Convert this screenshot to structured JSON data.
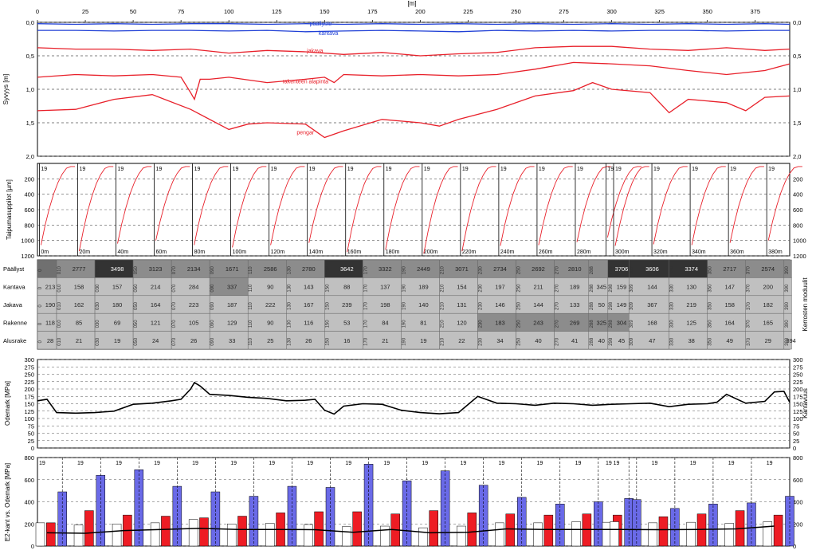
{
  "colors": {
    "blue_line": "#1f3fd6",
    "red_line": "#e8202a",
    "grid": "#555555",
    "table_cell": "#c0c0c0",
    "table_mid": "#8c8c8c",
    "table_dark": "#333333",
    "table_header": "#707070",
    "bar_red": "#ee1c24",
    "bar_blue": "#6a6ae8",
    "bar_white": "#ffffff"
  },
  "chart_data": [
    {
      "type": "line",
      "panel": "layers",
      "xlabel": "[m]",
      "ylabel": "Syvyys [m]",
      "xlim": [
        0,
        393
      ],
      "ylim": [
        2.0,
        0.0
      ],
      "xticks": [
        "0",
        "25",
        "50",
        "75",
        "100",
        "125",
        "150",
        "175",
        "200",
        "225",
        "250",
        "275",
        "300",
        "325",
        "350",
        "375"
      ],
      "xtick_values": [
        0,
        25,
        50,
        75,
        100,
        125,
        150,
        175,
        200,
        225,
        250,
        275,
        300,
        325,
        350,
        375
      ],
      "yticks": [
        "0,0",
        "0,5",
        "1,0",
        "1,5",
        "2,0"
      ],
      "ytick_values": [
        0,
        0.5,
        1.0,
        1.5,
        2.0
      ],
      "grid": true,
      "series": [
        {
          "name": "päällyste",
          "color": "blue",
          "x": [
            0,
            20,
            40,
            60,
            80,
            100,
            120,
            140,
            160,
            180,
            200,
            220,
            240,
            260,
            280,
            300,
            320,
            340,
            360,
            380,
            393
          ],
          "values": [
            0.02,
            0.03,
            0.02,
            0.03,
            0.02,
            0.02,
            0.03,
            0.02,
            0.03,
            0.02,
            0.03,
            0.02,
            0.03,
            0.02,
            0.03,
            0.02,
            0.03,
            0.02,
            0.03,
            0.02,
            0.03
          ]
        },
        {
          "name": "kantava",
          "color": "blue",
          "x": [
            0,
            20,
            40,
            60,
            80,
            100,
            120,
            140,
            160,
            180,
            200,
            220,
            240,
            260,
            280,
            300,
            320,
            340,
            360,
            380,
            393
          ],
          "values": [
            0.12,
            0.12,
            0.13,
            0.12,
            0.12,
            0.13,
            0.12,
            0.14,
            0.13,
            0.12,
            0.13,
            0.14,
            0.12,
            0.13,
            0.12,
            0.13,
            0.12,
            0.12,
            0.13,
            0.12,
            0.12
          ]
        },
        {
          "name": "jakava",
          "color": "red",
          "x": [
            0,
            20,
            40,
            60,
            80,
            100,
            120,
            140,
            160,
            180,
            200,
            220,
            240,
            260,
            280,
            300,
            320,
            340,
            360,
            380,
            393
          ],
          "values": [
            0.38,
            0.4,
            0.4,
            0.42,
            0.4,
            0.46,
            0.42,
            0.44,
            0.48,
            0.45,
            0.5,
            0.47,
            0.45,
            0.38,
            0.36,
            0.36,
            0.4,
            0.42,
            0.38,
            0.42,
            0.4
          ]
        },
        {
          "name": "rakenteen alapinta",
          "color": "red",
          "x": [
            0,
            20,
            40,
            60,
            75,
            80,
            82,
            85,
            90,
            100,
            120,
            140,
            150,
            155,
            160,
            180,
            200,
            220,
            240,
            260,
            280,
            300,
            320,
            340,
            360,
            380,
            393
          ],
          "values": [
            0.82,
            0.78,
            0.8,
            0.78,
            0.82,
            1.05,
            1.15,
            0.85,
            0.85,
            0.82,
            0.9,
            0.85,
            0.82,
            0.9,
            0.78,
            0.8,
            0.78,
            0.8,
            0.78,
            0.7,
            0.6,
            0.62,
            0.65,
            0.72,
            0.78,
            0.72,
            0.62
          ]
        },
        {
          "name": "pengar",
          "color": "red",
          "x": [
            0,
            20,
            40,
            60,
            80,
            100,
            110,
            120,
            140,
            150,
            160,
            180,
            200,
            210,
            220,
            240,
            260,
            280,
            290,
            300,
            320,
            330,
            340,
            360,
            370,
            380,
            393
          ],
          "values": [
            1.32,
            1.3,
            1.15,
            1.08,
            1.3,
            1.6,
            1.52,
            1.5,
            1.52,
            1.72,
            1.62,
            1.45,
            1.5,
            1.55,
            1.45,
            1.3,
            1.1,
            1.02,
            0.9,
            1.0,
            1.05,
            1.35,
            1.15,
            1.2,
            1.32,
            1.12,
            1.1
          ]
        }
      ]
    },
    {
      "type": "line",
      "panel": "deflection",
      "ylabel": "Taipumasuppilot [µm]",
      "ylim": [
        1200,
        0
      ],
      "yticks": [
        "200",
        "400",
        "600",
        "800",
        "1000",
        "1200"
      ],
      "ytick_values": [
        200,
        400,
        600,
        800,
        1000,
        1200
      ],
      "cell_tag": "19",
      "stations": [
        0,
        20,
        40,
        60,
        80,
        100,
        120,
        140,
        160,
        180,
        200,
        220,
        240,
        260,
        280,
        296,
        300,
        320,
        340,
        360,
        380
      ],
      "station_labels": [
        "0m",
        "20m",
        "40m",
        "60m",
        "80m",
        "100m",
        "120m",
        "140m",
        "160m",
        "180m",
        "200m",
        "220m",
        "240m",
        "260m",
        "280m",
        "",
        "300m",
        "320m",
        "340m",
        "360m",
        "380m"
      ],
      "d0_values": [
        1000,
        1080,
        980,
        940,
        1000,
        1030,
        1000,
        970,
        1090,
        1060,
        1110,
        1080,
        1010,
        1000,
        960,
        900,
        1010,
        990,
        1000,
        970,
        940
      ]
    },
    {
      "type": "table",
      "panel": "moduli",
      "ylabel": "Kerrosten moduulit",
      "rows": [
        "Päällyst",
        "Kantava",
        "Jakava",
        "Rakenne",
        "Alusrake"
      ],
      "columns": [
        {
          "start": "0",
          "end": "010",
          "values": [
            "",
            "213",
            "190",
            "118",
            "28"
          ],
          "shade": [
            "header",
            "cell",
            "cell",
            "cell",
            "cell"
          ]
        },
        {
          "start": "010",
          "end": "030",
          "values": [
            "2777",
            "158",
            "162",
            "85",
            "21"
          ],
          "shade": [
            "mid",
            "cell",
            "cell",
            "cell",
            "cell"
          ]
        },
        {
          "start": "030",
          "end": "050",
          "values": [
            "3498",
            "157",
            "180",
            "69",
            "19"
          ],
          "shade": [
            "dark",
            "cell",
            "cell",
            "cell",
            "cell"
          ]
        },
        {
          "start": "050",
          "end": "070",
          "values": [
            "3123",
            "214",
            "164",
            "121",
            "24"
          ],
          "shade": [
            "mid",
            "cell",
            "cell",
            "cell",
            "cell"
          ]
        },
        {
          "start": "070",
          "end": "090",
          "values": [
            "2134",
            "284",
            "223",
            "105",
            "26"
          ],
          "shade": [
            "mid",
            "cell",
            "cell",
            "cell",
            "cell"
          ]
        },
        {
          "start": "090",
          "end": "110",
          "values": [
            "1671",
            "337",
            "187",
            "129",
            "33"
          ],
          "shade": [
            "mid",
            "mid",
            "cell",
            "cell",
            "cell"
          ]
        },
        {
          "start": "110",
          "end": "130",
          "values": [
            "2586",
            "90",
            "222",
            "90",
            "25"
          ],
          "shade": [
            "mid",
            "cell",
            "cell",
            "cell",
            "cell"
          ]
        },
        {
          "start": "130",
          "end": "150",
          "values": [
            "2780",
            "143",
            "167",
            "116",
            "26"
          ],
          "shade": [
            "mid",
            "cell",
            "cell",
            "cell",
            "cell"
          ]
        },
        {
          "start": "150",
          "end": "170",
          "values": [
            "3642",
            "88",
            "239",
            "53",
            "16"
          ],
          "shade": [
            "dark",
            "cell",
            "cell",
            "cell",
            "cell"
          ]
        },
        {
          "start": "170",
          "end": "190",
          "values": [
            "3322",
            "137",
            "198",
            "84",
            "21"
          ],
          "shade": [
            "mid",
            "cell",
            "cell",
            "cell",
            "cell"
          ]
        },
        {
          "start": "190",
          "end": "210",
          "values": [
            "2449",
            "189",
            "140",
            "81",
            "19"
          ],
          "shade": [
            "mid",
            "cell",
            "cell",
            "cell",
            "cell"
          ]
        },
        {
          "start": "210",
          "end": "230",
          "values": [
            "3071",
            "154",
            "131",
            "120",
            "22"
          ],
          "shade": [
            "mid",
            "cell",
            "cell",
            "cell",
            "cell"
          ]
        },
        {
          "start": "230",
          "end": "250",
          "values": [
            "2734",
            "197",
            "146",
            "183",
            "34"
          ],
          "shade": [
            "mid",
            "cell",
            "cell",
            "mid",
            "cell"
          ]
        },
        {
          "start": "250",
          "end": "270",
          "values": [
            "2692",
            "211",
            "144",
            "243",
            "40"
          ],
          "shade": [
            "mid",
            "cell",
            "cell",
            "mid",
            "cell"
          ]
        },
        {
          "start": "270",
          "end": "288",
          "values": [
            "2810",
            "189",
            "133",
            "269",
            "41"
          ],
          "shade": [
            "mid",
            "cell",
            "cell",
            "mid",
            "cell"
          ]
        },
        {
          "start": "288",
          "end": "298",
          "values": [
            "",
            "345",
            "50",
            "325",
            "40"
          ],
          "shade": [
            "mid",
            "cell",
            "cell",
            "mid",
            "cell"
          ]
        },
        {
          "start": "298",
          "end": "309",
          "values": [
            "3706",
            "159",
            "149",
            "304",
            "45"
          ],
          "shade": [
            "dark",
            "cell",
            "cell",
            "mid",
            "cell"
          ]
        },
        {
          "start": "309",
          "end": "330",
          "values": [
            "3606",
            "144",
            "367",
            "168",
            "47"
          ],
          "shade": [
            "dark",
            "cell",
            "cell",
            "cell",
            "cell"
          ]
        },
        {
          "start": "330",
          "end": "350",
          "values": [
            "3374",
            "130",
            "219",
            "125",
            "38"
          ],
          "shade": [
            "dark",
            "cell",
            "cell",
            "cell",
            "cell"
          ]
        },
        {
          "start": "350",
          "end": "370",
          "values": [
            "2717",
            "147",
            "158",
            "164",
            "49"
          ],
          "shade": [
            "mid",
            "cell",
            "cell",
            "cell",
            "cell"
          ]
        },
        {
          "start": "370",
          "end": "390",
          "values": [
            "2574",
            "200",
            "182",
            "165",
            "29"
          ],
          "shade": [
            "mid",
            "cell",
            "cell",
            "cell",
            "cell"
          ]
        },
        {
          "start": "390",
          "end": "394",
          "values": [
            "",
            "",
            "",
            "",
            "394"
          ],
          "shade": [
            "mid",
            "cell",
            "cell",
            "cell",
            "cell"
          ]
        }
      ]
    },
    {
      "type": "line",
      "panel": "odemark",
      "ylabel": "Odemark [MPa]",
      "ylabel_right": "Kantavuus",
      "ylim": [
        0,
        300
      ],
      "yticks": [
        "0",
        "25",
        "50",
        "75",
        "100",
        "125",
        "150",
        "175",
        "200",
        "225",
        "250",
        "275",
        "300"
      ],
      "ytick_values": [
        0,
        25,
        50,
        75,
        100,
        125,
        150,
        175,
        200,
        225,
        250,
        275,
        300
      ],
      "x": [
        0,
        5,
        10,
        20,
        30,
        40,
        50,
        60,
        70,
        75,
        80,
        82,
        85,
        90,
        100,
        110,
        120,
        130,
        140,
        145,
        150,
        155,
        160,
        170,
        180,
        190,
        200,
        210,
        220,
        230,
        240,
        250,
        260,
        270,
        280,
        290,
        300,
        310,
        320,
        330,
        340,
        350,
        355,
        360,
        370,
        380,
        385,
        390,
        393
      ],
      "values": [
        160,
        165,
        120,
        118,
        120,
        125,
        148,
        152,
        160,
        165,
        200,
        222,
        210,
        182,
        178,
        172,
        168,
        160,
        162,
        165,
        128,
        115,
        142,
        150,
        148,
        128,
        120,
        116,
        120,
        175,
        152,
        150,
        145,
        152,
        150,
        145,
        148,
        150,
        152,
        140,
        148,
        150,
        155,
        182,
        152,
        158,
        190,
        192,
        155
      ]
    },
    {
      "type": "bar",
      "panel": "e2",
      "ylabel": "E2-kant vs. Odemark [MPa]",
      "ylim": [
        0,
        800
      ],
      "yticks": [
        "0",
        "200",
        "400",
        "600",
        "800"
      ],
      "ytick_values": [
        0,
        200,
        400,
        600,
        800
      ],
      "cell_tag": "19",
      "stations": [
        0,
        20,
        40,
        60,
        80,
        100,
        120,
        140,
        160,
        180,
        200,
        220,
        240,
        260,
        280,
        296,
        300,
        320,
        340,
        360,
        380
      ],
      "series": [
        {
          "name": "red",
          "values": [
            210,
            320,
            280,
            270,
            255,
            270,
            300,
            310,
            310,
            290,
            320,
            300,
            290,
            280,
            290,
            280,
            0,
            265,
            290,
            320,
            280
          ]
        },
        {
          "name": "blue",
          "values": [
            490,
            640,
            690,
            540,
            490,
            450,
            540,
            530,
            740,
            590,
            680,
            550,
            440,
            380,
            400,
            430,
            420,
            340,
            380,
            390,
            450
          ]
        },
        {
          "name": "white",
          "values": [
            210,
            190,
            200,
            210,
            240,
            200,
            205,
            195,
            175,
            180,
            165,
            180,
            210,
            210,
            220,
            215,
            220,
            210,
            215,
            205,
            220
          ]
        }
      ],
      "line_values": [
        120,
        115,
        140,
        150,
        160,
        150,
        150,
        148,
        125,
        150,
        120,
        125,
        155,
        150,
        150,
        150,
        150,
        148,
        150,
        155,
        180
      ]
    }
  ]
}
